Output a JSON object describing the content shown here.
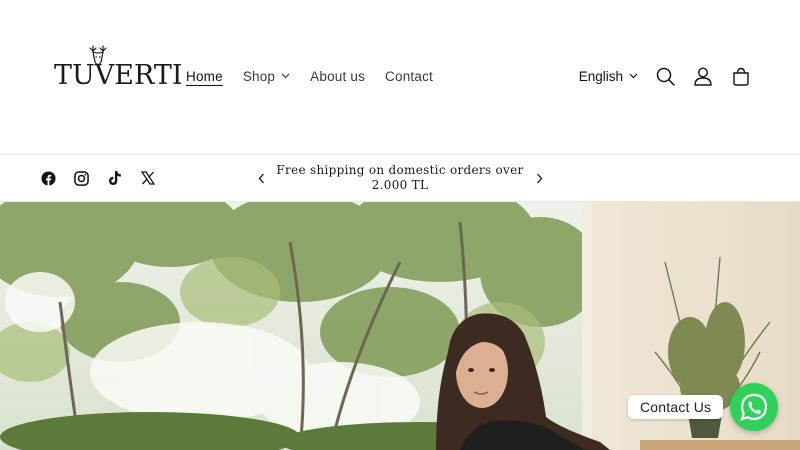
{
  "brand": {
    "name": "TUVERTI",
    "logo_icon": "deer-head-icon"
  },
  "nav": {
    "items": [
      {
        "label": "Home",
        "active": true
      },
      {
        "label": "Shop",
        "has_dropdown": true
      },
      {
        "label": "About us"
      },
      {
        "label": "Contact"
      }
    ]
  },
  "header": {
    "language": "English",
    "icons": [
      "search-icon",
      "account-icon",
      "cart-icon"
    ]
  },
  "social": [
    "facebook-icon",
    "instagram-icon",
    "tiktok-icon",
    "x-icon"
  ],
  "announcement": {
    "text": "Free shipping on domestic orders over 2.000 TL"
  },
  "chat": {
    "label": "Contact Us",
    "icon": "whatsapp-icon",
    "color": "#2fd15a"
  }
}
